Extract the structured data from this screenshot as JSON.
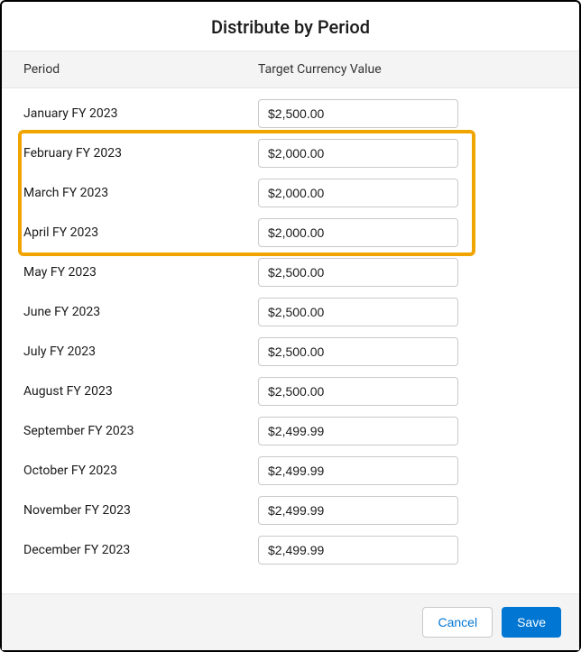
{
  "dialog": {
    "title": "Distribute by Period"
  },
  "table": {
    "headers": {
      "period": "Period",
      "value": "Target Currency Value"
    },
    "rows": [
      {
        "period": "January FY 2023",
        "value": "$2,500.00"
      },
      {
        "period": "February FY 2023",
        "value": "$2,000.00"
      },
      {
        "period": "March FY 2023",
        "value": "$2,000.00"
      },
      {
        "period": "April FY 2023",
        "value": "$2,000.00"
      },
      {
        "period": "May FY 2023",
        "value": "$2,500.00"
      },
      {
        "period": "June FY 2023",
        "value": "$2,500.00"
      },
      {
        "period": "July FY 2023",
        "value": "$2,500.00"
      },
      {
        "period": "August FY 2023",
        "value": "$2,500.00"
      },
      {
        "period": "September FY 2023",
        "value": "$2,499.99"
      },
      {
        "period": "October FY 2023",
        "value": "$2,499.99"
      },
      {
        "period": "November FY 2023",
        "value": "$2,499.99"
      },
      {
        "period": "December FY 2023",
        "value": "$2,499.99"
      }
    ]
  },
  "highlight": {
    "startRow": 1,
    "endRow": 3
  },
  "footer": {
    "cancel": "Cancel",
    "save": "Save"
  }
}
